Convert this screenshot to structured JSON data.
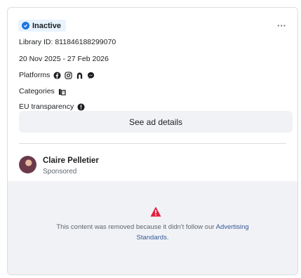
{
  "status": {
    "label": "Inactive"
  },
  "more_menu": {
    "label": "···"
  },
  "library_id": "Library ID: 811846188299070",
  "date_range": "20 Nov 2025 - 27 Feb 2026",
  "platforms": {
    "label": "Platforms",
    "icons": [
      "facebook-icon",
      "instagram-icon",
      "audience-network-icon",
      "messenger-icon"
    ]
  },
  "categories": {
    "label": "Categories",
    "icon": "category-icon"
  },
  "eu_transparency": {
    "label": "EU transparency",
    "icon": "info-icon"
  },
  "details_button": {
    "label": "See ad details"
  },
  "advertiser": {
    "name": "Claire Pelletier",
    "sponsored": "Sponsored"
  },
  "removed": {
    "text": "This content was removed because it didn't follow our ",
    "link_part1": "Advertising",
    "link_part2": "Standards",
    "end": "."
  },
  "colors": {
    "accent": "#1b74e4",
    "warning": "#e41e3f",
    "link": "#385898",
    "muted_bg": "#f0f2f5"
  }
}
